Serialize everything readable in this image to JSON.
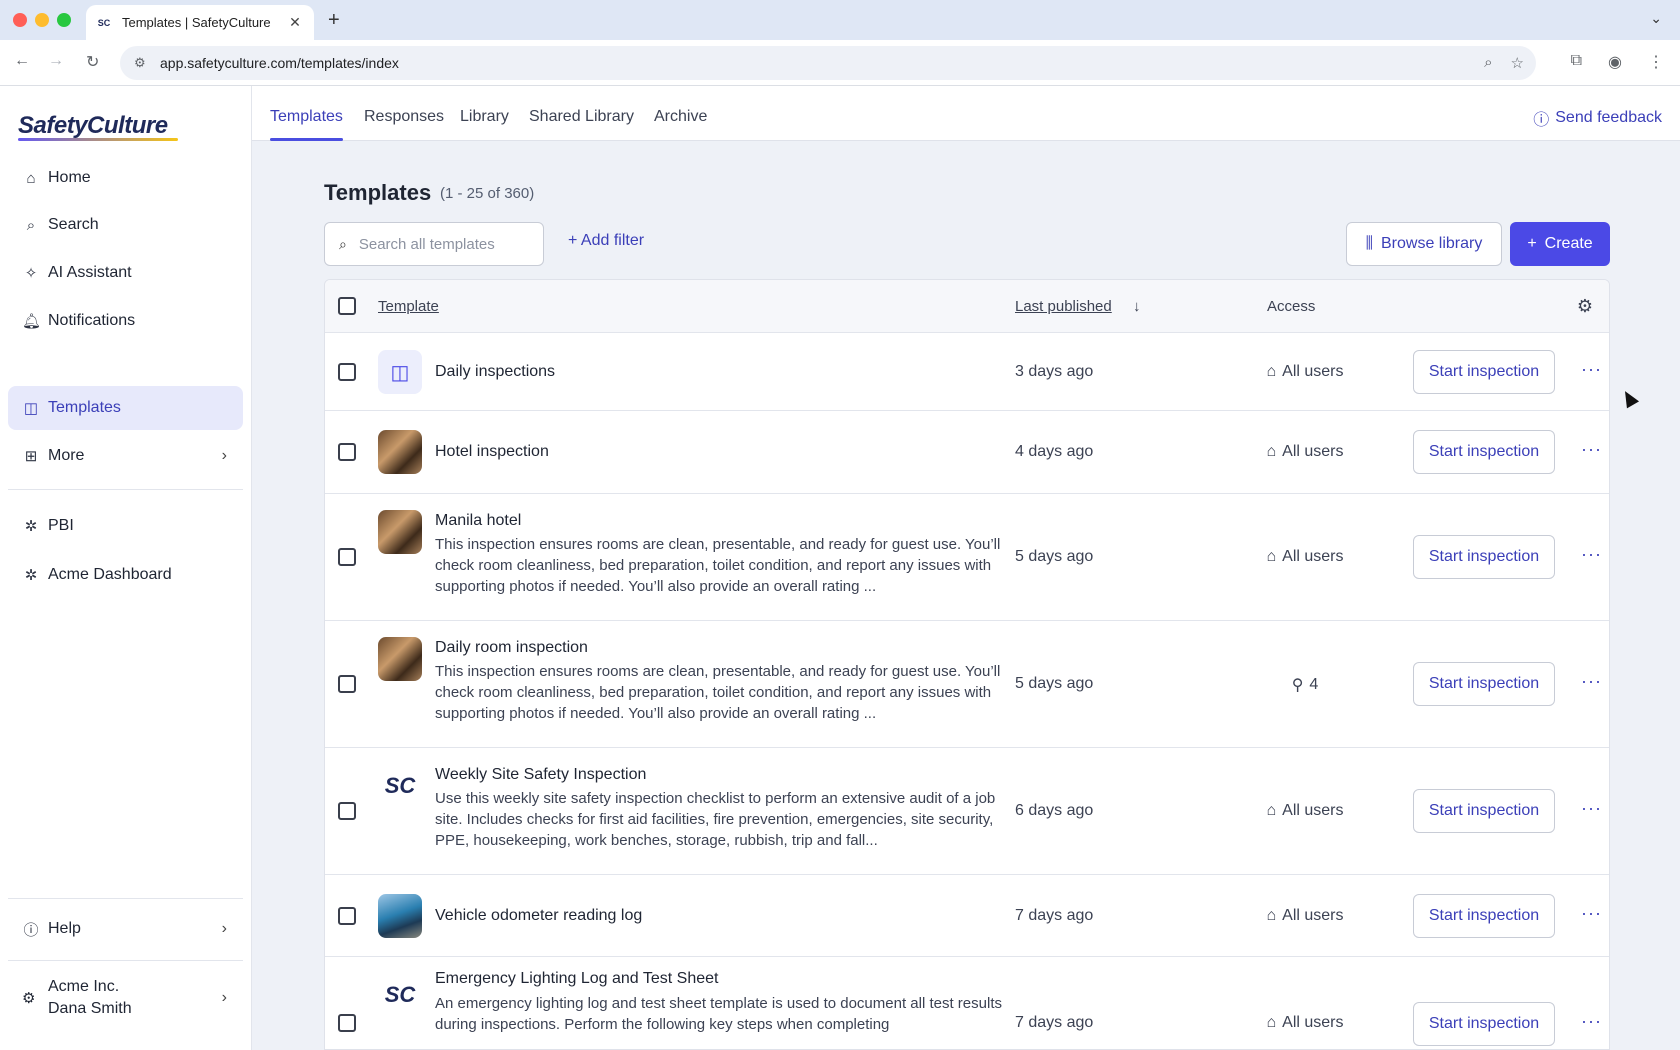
{
  "browser": {
    "tab_title": "Templates | SafetyCulture",
    "tab_favicon": "SC",
    "url": "app.safetyculture.com/templates/index"
  },
  "sidebar": {
    "logo": "SafetyCulture",
    "items": [
      {
        "label": "Home",
        "icon": "home-icon"
      },
      {
        "label": "Search",
        "icon": "search-icon"
      },
      {
        "label": "AI Assistant",
        "icon": "sparkle-icon"
      },
      {
        "label": "Notifications",
        "icon": "bell-icon"
      },
      {
        "label": "Templates",
        "icon": "template-icon"
      },
      {
        "label": "More",
        "icon": "grid-icon"
      },
      {
        "label": "PBI",
        "icon": "puzzle-icon"
      },
      {
        "label": "Acme Dashboard",
        "icon": "puzzle-icon"
      }
    ],
    "help": "Help",
    "org_name": "Acme Inc.",
    "user_name": "Dana Smith"
  },
  "topnav": {
    "tabs": [
      "Templates",
      "Responses",
      "Library",
      "Shared Library",
      "Archive"
    ],
    "active": "Templates",
    "feedback": "Send feedback"
  },
  "main": {
    "title": "Templates",
    "count": "(1 - 25 of 360)",
    "search_placeholder": "Search all templates",
    "add_filter": "Add filter",
    "browse_library": "Browse library",
    "create": "Create"
  },
  "table": {
    "headers": {
      "template": "Template",
      "last_published": "Last published",
      "access": "Access"
    },
    "start_label": "Start inspection",
    "rows": [
      {
        "name": "Daily inspections",
        "desc": "",
        "date": "3 days ago",
        "access": "All users",
        "access_icon": "building-icon",
        "thumb": "grid"
      },
      {
        "name": "Hotel inspection",
        "desc": "",
        "date": "4 days ago",
        "access": "All users",
        "access_icon": "building-icon",
        "thumb": "photo"
      },
      {
        "name": "Manila hotel",
        "desc": "This inspection ensures rooms are clean, presentable, and ready for guest use. You’ll check room cleanliness, bed preparation, toilet condition, and report any issues with supporting photos if needed. You’ll also provide an overall rating ...",
        "date": "5 days ago",
        "access": "All users",
        "access_icon": "building-icon",
        "thumb": "photo"
      },
      {
        "name": "Daily room inspection",
        "desc": "This inspection ensures rooms are clean, presentable, and ready for guest use. You’ll check room cleanliness, bed preparation, toilet condition, and report any issues with supporting photos if needed. You’ll also provide an overall rating ...",
        "date": "5 days ago",
        "access": "4",
        "access_icon": "user-icon",
        "thumb": "photo"
      },
      {
        "name": "Weekly Site Safety Inspection",
        "desc": "Use this weekly site safety inspection checklist to perform an extensive audit of a job site. Includes checks for first aid facilities, fire prevention, emergencies, site security, PPE, housekeeping, work benches, storage, rubbish, trip and fall...",
        "date": "6 days ago",
        "access": "All users",
        "access_icon": "building-icon",
        "thumb": "sc"
      },
      {
        "name": "Vehicle odometer reading log",
        "desc": "",
        "date": "7 days ago",
        "access": "All users",
        "access_icon": "building-icon",
        "thumb": "truck"
      },
      {
        "name": "Emergency Lighting Log and Test Sheet",
        "desc": "An emergency lighting log and test sheet template is used to document all test results during inspections. Perform the following key steps when completing",
        "date": "7 days ago",
        "access": "All users",
        "access_icon": "building-icon",
        "thumb": "sc"
      }
    ]
  },
  "colors": {
    "accent": "#4b49e6",
    "link": "#3b3fb8",
    "active_bg": "#e7e9fb"
  }
}
